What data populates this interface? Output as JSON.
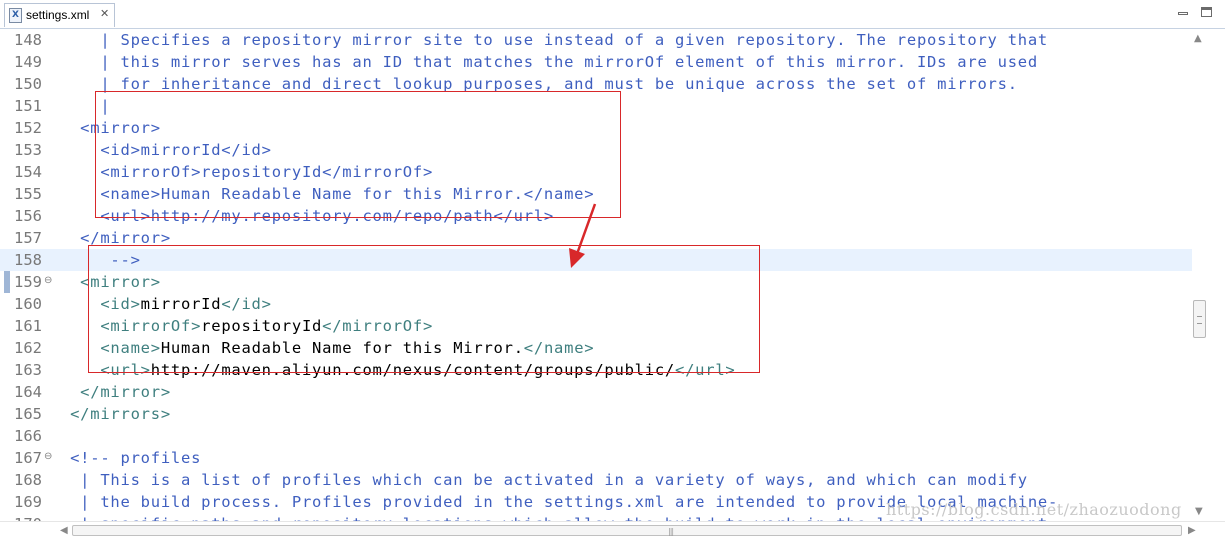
{
  "tab": {
    "filename": "settings.xml",
    "close_glyph": "✕",
    "file_icon": "xml-file-icon"
  },
  "window_controls": {
    "minimize": "minimize-icon",
    "maximize": "maximize-icon"
  },
  "editor": {
    "current_line": 158,
    "lines": [
      {
        "n": "148",
        "fold": "",
        "segs": [
          {
            "t": "    | Specifies a repository mirror site to use instead of a given repository. The repository that",
            "c": "comment"
          }
        ]
      },
      {
        "n": "149",
        "fold": "",
        "segs": [
          {
            "t": "    | this mirror serves has an ID that matches the mirrorOf element of this mirror. IDs are used",
            "c": "comment"
          }
        ]
      },
      {
        "n": "150",
        "fold": "",
        "segs": [
          {
            "t": "    | for inheritance and direct lookup purposes, and must be unique across the set of mirrors.",
            "c": "comment"
          }
        ]
      },
      {
        "n": "151",
        "fold": "",
        "segs": [
          {
            "t": "    |",
            "c": "comment"
          }
        ]
      },
      {
        "n": "152",
        "fold": "",
        "segs": [
          {
            "t": "  <mirror>",
            "c": "comment"
          }
        ]
      },
      {
        "n": "153",
        "fold": "",
        "segs": [
          {
            "t": "    <id>mirrorId</id>",
            "c": "comment"
          }
        ]
      },
      {
        "n": "154",
        "fold": "",
        "segs": [
          {
            "t": "    <mirrorOf>repositoryId</mirrorOf>",
            "c": "comment"
          }
        ]
      },
      {
        "n": "155",
        "fold": "",
        "segs": [
          {
            "t": "    <name>Human Readable Name for this Mirror.</name>",
            "c": "comment"
          }
        ]
      },
      {
        "n": "156",
        "fold": "",
        "segs": [
          {
            "t": "    <url>http://my.repository.com/repo/path</url>",
            "c": "comment"
          }
        ]
      },
      {
        "n": "157",
        "fold": "",
        "segs": [
          {
            "t": "  </mirror>",
            "c": "comment"
          }
        ]
      },
      {
        "n": "158",
        "fold": "",
        "segs": [
          {
            "t": "     -->",
            "c": "comment"
          }
        ]
      },
      {
        "n": "159",
        "fold": "⊖",
        "segs": [
          {
            "t": "  <mirror>",
            "c": "tag"
          }
        ]
      },
      {
        "n": "160",
        "fold": "",
        "segs": [
          {
            "t": "    <id>",
            "c": "tag"
          },
          {
            "t": "mirrorId",
            "c": "text"
          },
          {
            "t": "</id>",
            "c": "tag"
          }
        ]
      },
      {
        "n": "161",
        "fold": "",
        "segs": [
          {
            "t": "    <mirrorOf>",
            "c": "tag"
          },
          {
            "t": "repositoryId",
            "c": "text"
          },
          {
            "t": "</mirrorOf>",
            "c": "tag"
          }
        ]
      },
      {
        "n": "162",
        "fold": "",
        "segs": [
          {
            "t": "    <name>",
            "c": "tag"
          },
          {
            "t": "Human Readable Name for this Mirror.",
            "c": "text"
          },
          {
            "t": "</name>",
            "c": "tag"
          }
        ]
      },
      {
        "n": "163",
        "fold": "",
        "segs": [
          {
            "t": "    <url>",
            "c": "tag"
          },
          {
            "t": "http://maven.aliyun.com/nexus/content/groups/public/",
            "c": "text"
          },
          {
            "t": "</url>",
            "c": "tag"
          }
        ]
      },
      {
        "n": "164",
        "fold": "",
        "segs": [
          {
            "t": "  </mirror>",
            "c": "tag"
          }
        ]
      },
      {
        "n": "165",
        "fold": "",
        "segs": [
          {
            "t": " </mirrors>",
            "c": "tag"
          }
        ]
      },
      {
        "n": "166",
        "fold": "",
        "segs": [
          {
            "t": "",
            "c": "text"
          }
        ]
      },
      {
        "n": "167",
        "fold": "⊖",
        "segs": [
          {
            "t": " <!-- profiles",
            "c": "comment"
          }
        ]
      },
      {
        "n": "168",
        "fold": "",
        "segs": [
          {
            "t": "  | This is a list of profiles which can be activated in a variety of ways, and which can modify",
            "c": "comment"
          }
        ]
      },
      {
        "n": "169",
        "fold": "",
        "segs": [
          {
            "t": "  | the build process. Profiles provided in the settings.xml are intended to provide local machine-",
            "c": "comment"
          }
        ]
      },
      {
        "n": "170",
        "fold": "",
        "segs": [
          {
            "t": "  | specific paths and repository locations which allow the build to work in the local environment.",
            "c": "comment"
          }
        ]
      }
    ]
  },
  "watermark": "https://blog.csdn.net/zhaozuodong",
  "colors": {
    "comment": "#3f5fbf",
    "tag": "#3f7f7f",
    "text": "#000000",
    "annotation": "#d8282a",
    "current_line_bg": "#e8f2fe"
  }
}
